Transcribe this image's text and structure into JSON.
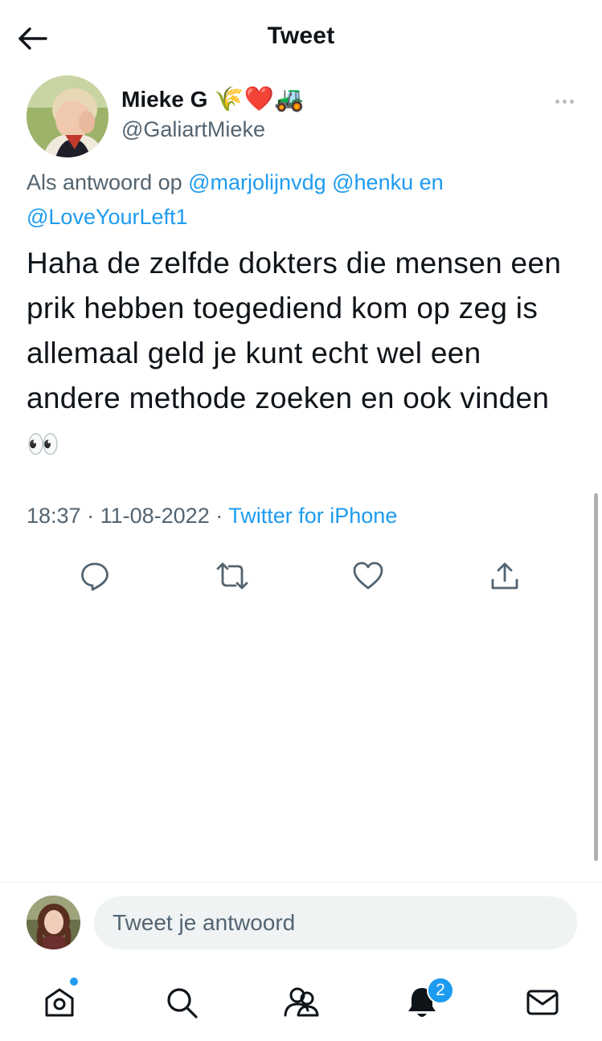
{
  "header": {
    "title": "Tweet",
    "back_icon": "arrow-left-icon"
  },
  "author": {
    "name": "Mieke G",
    "emojis": "🌾❤️🚜",
    "handle": "@GaliartMieke"
  },
  "reply_context": {
    "prefix": "Als antwoord op",
    "mention_1": "@marjolijnvdg",
    "mention_2": "@henku",
    "conjunction": "en",
    "mention_3": "@LoveYourLeft1"
  },
  "tweet": {
    "text": "Haha de zelfde dokters die mensen een prik hebben toegediend kom op zeg is allemaal geld je kunt echt wel een andere methode zoeken en ook vinden",
    "emoji": "👀"
  },
  "meta": {
    "time": "18:37",
    "separator": "·",
    "date": "11-08-2022",
    "source": "Twitter for iPhone"
  },
  "actions": [
    "reply-icon",
    "retweet-icon",
    "like-icon",
    "share-icon"
  ],
  "composer": {
    "placeholder": "Tweet je antwoord"
  },
  "tabbar": {
    "items": [
      "home-icon",
      "search-icon",
      "communities-icon",
      "notifications-icon",
      "messages-icon"
    ],
    "notifications_badge": "2"
  },
  "colors": {
    "accent": "#1d9bf0",
    "secondary_text": "#536471",
    "primary_text": "#0f1419"
  }
}
